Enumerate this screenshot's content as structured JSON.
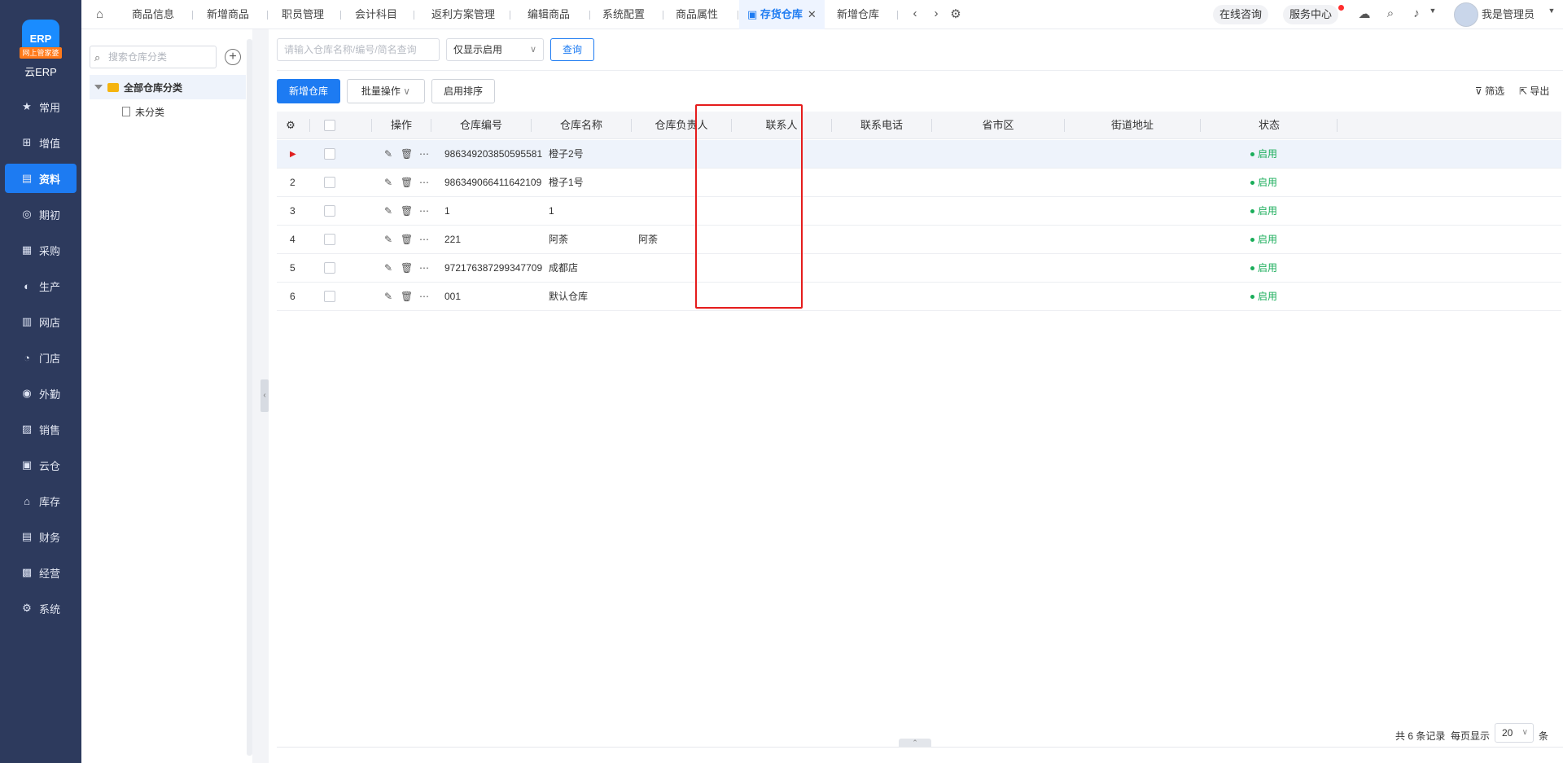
{
  "nav": {
    "logo_text": "ERP",
    "logo_tag": "网上管家婆",
    "logo_sub": "云ERP",
    "items": [
      {
        "label": "常用",
        "icon": "star-icon",
        "glyph": "★"
      },
      {
        "label": "增值",
        "icon": "plus-square-icon",
        "glyph": "⊞"
      },
      {
        "label": "资料",
        "icon": "document-icon",
        "glyph": "▤",
        "active": true
      },
      {
        "label": "期初",
        "icon": "target-icon",
        "glyph": "◎"
      },
      {
        "label": "采购",
        "icon": "purchase-icon",
        "glyph": "▦"
      },
      {
        "label": "生产",
        "icon": "production-icon",
        "glyph": "◐"
      },
      {
        "label": "网店",
        "icon": "shop-icon",
        "glyph": "▥"
      },
      {
        "label": "门店",
        "icon": "store-icon",
        "glyph": "◔"
      },
      {
        "label": "外勤",
        "icon": "field-icon",
        "glyph": "◉"
      },
      {
        "label": "销售",
        "icon": "sales-chart-icon",
        "glyph": "▨"
      },
      {
        "label": "云仓",
        "icon": "cloud-warehouse-icon",
        "glyph": "▣"
      },
      {
        "label": "库存",
        "icon": "inventory-icon",
        "glyph": "⌂"
      },
      {
        "label": "财务",
        "icon": "finance-icon",
        "glyph": "▤"
      },
      {
        "label": "经营",
        "icon": "business-icon",
        "glyph": "▩"
      },
      {
        "label": "系统",
        "icon": "system-gear-icon",
        "glyph": "⚙"
      }
    ]
  },
  "topbar": {
    "tabs": [
      {
        "label": "商品信息"
      },
      {
        "label": "新增商品"
      },
      {
        "label": "职员管理"
      },
      {
        "label": "会计科目"
      },
      {
        "label": "返利方案管理"
      },
      {
        "label": "编辑商品"
      },
      {
        "label": "系统配置"
      },
      {
        "label": "商品属性"
      },
      {
        "label": "存货仓库",
        "active": true
      },
      {
        "label": "新增仓库"
      }
    ],
    "close_glyph": "✕",
    "online_consult": "在线咨询",
    "service_center": "服务中心",
    "user_name": "我是管理员"
  },
  "category": {
    "search_placeholder": "搜索仓库分类",
    "root_label": "全部仓库分类",
    "child_label": "未分类"
  },
  "filters": {
    "search_placeholder": "请输入仓库名称/编号/简名查询",
    "select_value": "仅显示启用",
    "query_label": "查询"
  },
  "toolbar": {
    "add_label": "新增仓库",
    "batch_label": "批量操作",
    "sort_label": "启用排序",
    "filter_label": "筛选",
    "export_label": "导出"
  },
  "table": {
    "headers": {
      "ops": "操作",
      "code": "仓库编号",
      "name": "仓库名称",
      "manager": "仓库负责人",
      "contact": "联系人",
      "phone": "联系电话",
      "region": "省市区",
      "address": "街道地址",
      "status": "状态"
    },
    "rows": [
      {
        "no": "▶",
        "code": "986349203850595581",
        "name": "橙子2号",
        "manager": "",
        "status": "启用"
      },
      {
        "no": "2",
        "code": "986349066411642109",
        "name": "橙子1号",
        "manager": "",
        "status": "启用"
      },
      {
        "no": "3",
        "code": "1",
        "name": "1",
        "manager": "",
        "status": "启用"
      },
      {
        "no": "4",
        "code": "221",
        "name": "阿荼",
        "manager": "阿荼",
        "status": "启用"
      },
      {
        "no": "5",
        "code": "972176387299347709",
        "name": "成都店",
        "manager": "",
        "status": "启用"
      },
      {
        "no": "6",
        "code": "001",
        "name": "默认仓库",
        "manager": "",
        "status": "启用"
      }
    ]
  },
  "pager": {
    "total_text": "共 6 条记录",
    "per_page_label": "每页显示",
    "per_page_value": "20",
    "unit": "条"
  },
  "colors": {
    "accent": "#1d7bf2",
    "sidebar": "#2d3a5d",
    "status_green": "#1aad5a",
    "highlight_red": "#e51c1c"
  }
}
